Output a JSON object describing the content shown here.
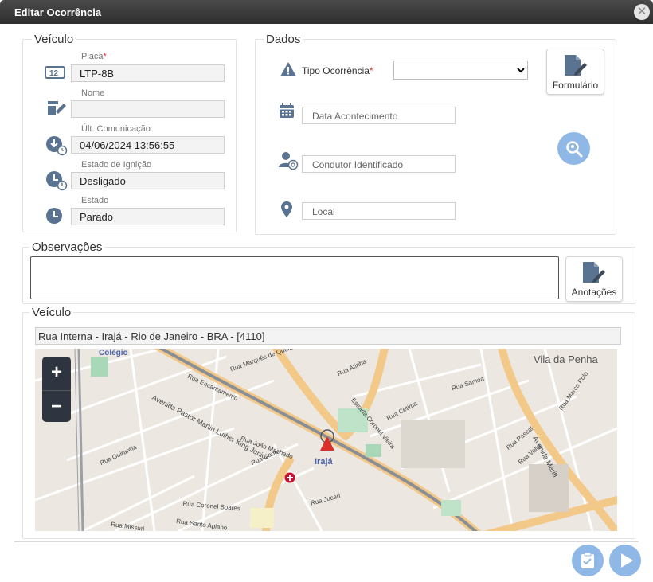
{
  "window": {
    "title": "Editar Ocorrência",
    "close_glyph": "✕"
  },
  "veiculo_section": {
    "legend": "Veículo",
    "fields": [
      {
        "label": "Placa",
        "required": true,
        "value": "LTP-8B",
        "icon": "license-plate-icon"
      },
      {
        "label": "Nome",
        "required": false,
        "value": "",
        "icon": "edit-signature-icon"
      },
      {
        "label": "Últ. Comunicação",
        "required": false,
        "value": "04/06/2024 13:56:55",
        "icon": "download-clock-icon"
      },
      {
        "label": "Estado de Ignição",
        "required": false,
        "value": "Desligado",
        "icon": "clock-power-icon"
      },
      {
        "label": "Estado",
        "required": false,
        "value": "Parado",
        "icon": "clock-icon"
      }
    ]
  },
  "dados_section": {
    "legend": "Dados",
    "tipo_ocorrencia_label": "Tipo Ocorrência",
    "tipo_ocorrencia_value": "",
    "data_placeholder": "Data Acontecimento",
    "condutor_placeholder": "Condutor Identificado",
    "local_placeholder": "Local",
    "formulario_label": "Formulário"
  },
  "observacoes_section": {
    "legend": "Observações",
    "value": "",
    "anotacoes_label": "Anotações"
  },
  "mapa_section": {
    "legend": "Veículo",
    "address": "Rua Interna - Irajá - Rio de Janeiro - BRA - [4110]",
    "zoom_in": "+",
    "zoom_out": "−",
    "labels": {
      "vila_penha": "Vila da Penha",
      "iraja": "Irajá",
      "colegio": "Colégio",
      "av_martin": "Avenida Pastor Martin Luther King Junior",
      "av_meriti": "Avenida Meriti",
      "estrada_vieira": "Estrada Coronel Vieira",
      "rua_guiraria": "Rua Guiraréia",
      "rua_joao_machado": "Rua João Machado",
      "rua_samoa": "Rua Samoa",
      "rua_cetima": "Rua Cetima",
      "rua_caobi": "Rua Caobi",
      "rua_jucari": "Rua Jucari",
      "rua_atiriba": "Rua Atiriba",
      "rua_marques": "Rua Marquês de Queluz",
      "rua_encantamento": "Rua Encantamento",
      "rua_coronel_soares": "Rua Coronel Soares",
      "rua_santo_apiano": "Rua Santo Apiano",
      "rua_missuri": "Rua Missuri",
      "rua_marco_polo": "Rua Marco Polo",
      "rua_volta": "Rua Volta",
      "rua_pascal": "Rua Pascal"
    }
  },
  "footer": {
    "checklist_icon": "clipboard-check-icon",
    "next_icon": "play-icon"
  },
  "colors": {
    "accent": "#8fb8e6",
    "titlebar": "#3a3a3a",
    "road_major": "#f3c98a"
  }
}
